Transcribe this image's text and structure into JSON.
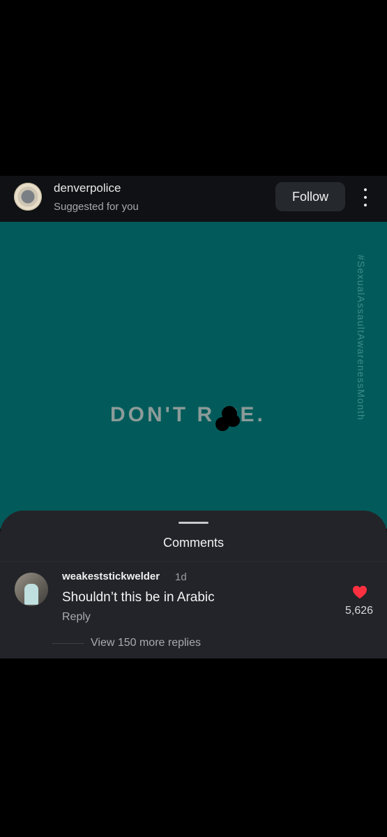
{
  "post": {
    "username": "denverpolice",
    "subtitle": "Suggested for you",
    "follow_label": "Follow",
    "more_icon": "more-vertical-icon",
    "image": {
      "background_color": "#025b5a",
      "hashtag": "#SexualAssaultAwarenessMonth",
      "headline": "DON'T R  PE."
    }
  },
  "comments_sheet": {
    "title": "Comments",
    "comments": [
      {
        "username": "weakeststickwelder",
        "time": "1d",
        "text": "Shouldn’t this be in Arabic",
        "reply_label": "Reply",
        "likes": "5,626",
        "liked": true,
        "heart_color": "#ff3040",
        "view_replies": "View 150 more replies"
      }
    ]
  }
}
